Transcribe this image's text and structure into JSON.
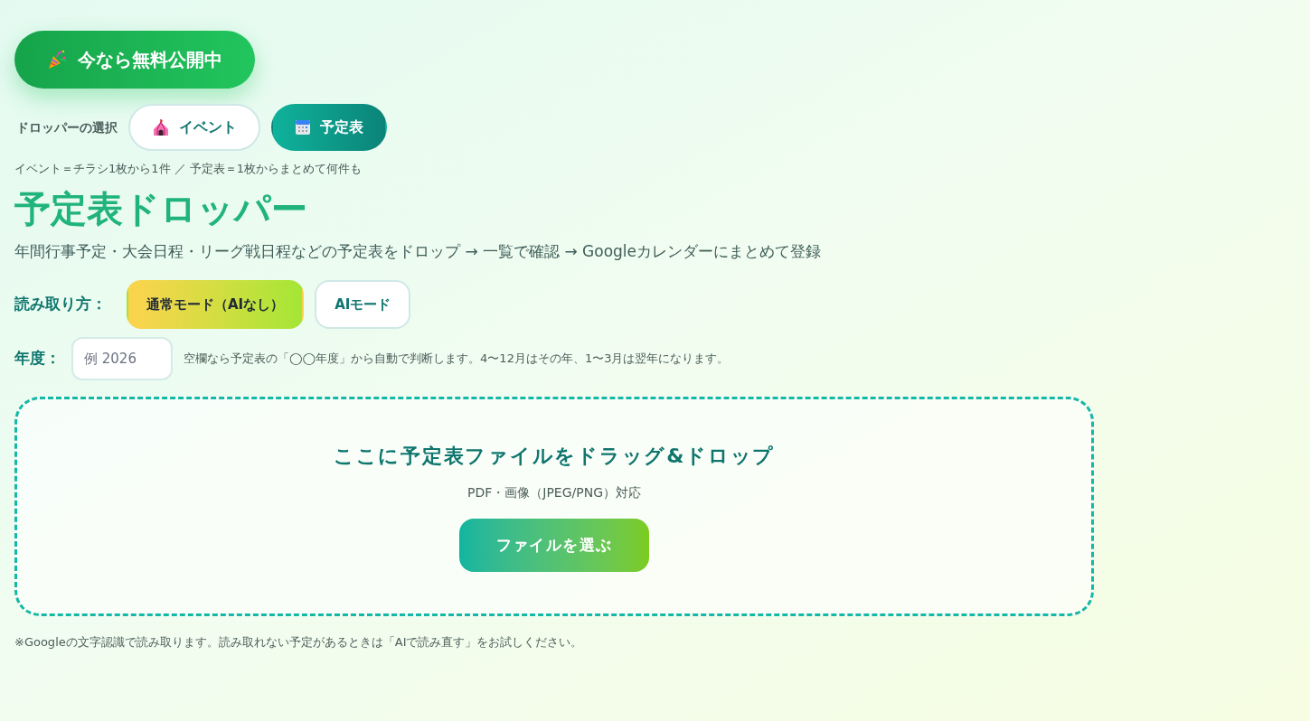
{
  "promo_badge": {
    "label": "今なら無料公開中"
  },
  "dropper_select": {
    "label": "ドロッパーの選択",
    "options": [
      {
        "kind": "event",
        "label": "イベント",
        "selected": false
      },
      {
        "kind": "schedule",
        "label": "予定表",
        "selected": true
      }
    ],
    "note": "イベント＝チラシ1枚から1件 ／ 予定表＝1枚からまとめて何件も"
  },
  "title": "予定表ドロッパー",
  "subtitle": "年間行事予定・大会日程・リーグ戦日程などの予定表をドロップ → 一覧で確認 → Googleカレンダーにまとめて登録",
  "reading_mode": {
    "label": "読み取り方：",
    "options": [
      {
        "label": "通常モード（AIなし）",
        "selected": true
      },
      {
        "label": "AIモード",
        "selected": false
      }
    ]
  },
  "year": {
    "label": "年度：",
    "placeholder": "例 2026",
    "hint": "空欄なら予定表の「◯◯年度」から自動で判断します。4〜12月はその年、1〜3月は翌年になります。"
  },
  "drop_zone": {
    "title": "ここに予定表ファイルをドラッグ&ドロップ",
    "formats": "PDF・画像（JPEG/PNG）対応",
    "button": "ファイルを選ぶ"
  },
  "footnote": "※Googleの文字認識で読み取ります。読み取れない予定があるときは「AIで読み直す」をお試しください。"
}
